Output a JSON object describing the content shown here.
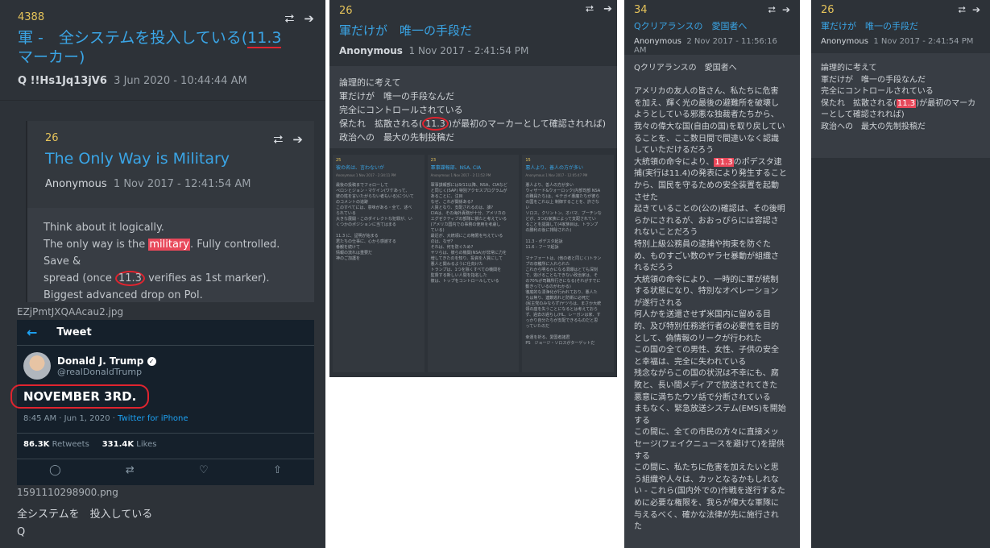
{
  "panel1": {
    "post_number": "4388",
    "title_prefix": "軍 -　全システムを投入している(",
    "title_marker": "11.3",
    "title_suffix": " マーカー)",
    "trip": "Q  !!Hs1Jq13jV6",
    "date": "3 Jun 2020 - 10:44:44 AM",
    "quote": {
      "number": "26",
      "title": "The Only Way is Military",
      "author": "Anonymous",
      "date": "1 Nov 2017 - 12:41:54 AM",
      "line1": "Think about it logically.",
      "line2_a": "The only way is the ",
      "line2_hl": "military",
      "line2_b": ". Fully controlled. Save &",
      "line3_a": "spread (once ",
      "line3_c": "11.3",
      "line3_b": " verifies as 1st marker).",
      "line4": "Biggest advanced drop on Pol."
    },
    "file1": "EZjPmtJXQAAcau2.jpg",
    "tweet": {
      "header": "Tweet",
      "name": "Donald J. Trump",
      "handle": "@realDonaldTrump",
      "text": "NOVEMBER 3RD.",
      "time": "8:45 AM · Jun 1, 2020 · ",
      "source": "Twitter for iPhone",
      "retweets": "86.3K",
      "retweets_label": "Retweets",
      "likes": "331.4K",
      "likes_label": "Likes"
    },
    "file2": "1591110298900.png",
    "footer_line1": "全システムを　投入している",
    "footer_line2": "Q"
  },
  "panel2": {
    "post_number": "26",
    "title": "軍だけが　唯一の手段だ",
    "author": "Anonymous",
    "date": "1 Nov 2017 - 2:41:54 PM",
    "line1": "論理的に考えて",
    "line2": "軍だけが　唯一の手段なんだ",
    "line3": "完全にコントロールされている",
    "line4_a": "保たれ　拡散される(",
    "line4_c": "11.3",
    "line4_b": ")が最初のマーカーとして確認されれば)",
    "line5": "政治への　最大の先制投稿だ",
    "minis": [
      {
        "number": "25",
        "title": "彼の名は、言わないが",
        "meta": "Anonymous  1 Nov 2017 - 2:34:11 PM",
        "body": "最後の投稿までフォローして\nペロシとジョン・マケイン(ワケあって、\n彼の姓を言いたがらない者もいる)について\nのコメントの追跡\nこのすべてには、意味がある・全て、述べ\nられている\n大きな展開・このダイレクトな犯罪が、い\nくつかのポジションに当てはまる\n\n11.3 に、証明が始まる\n君たちの仕事に、心から感謝する\n番観を続けて\n情報の流れは重要だ\n神のご加護を"
      },
      {
        "number": "23",
        "title": "軍事諜報部、NSA, CIA",
        "meta": "Anonymous  1 Nov 2017 - 2:11:52 PM",
        "body": "軍事諜報部には9/11以降、NSA、CIAなど\nと同じく(SAP) 特別アクセスプログラムが\nあることに、注目\nなぜ、これが関係ある?\n人質となり、支配されるのは、誰?\nCIAは、その海外責務が十分、アメリカの\nエグゼクティブの部隊に損たと考えている\n(アメリカ国内での事務の使用を考慮し\nている)\n最近が、大統領にこの権限を与えている\nのは、なぜ?\nそれは、何を防ぐため?\nヤツらは、彼らの機関(NSA)が非常に力を\n増してきたのを知り、投資を人質にして\n悪人と関わるように仕向けた\nトランプは、1つを除くすべての機関を\n監督する新しい人間を指名した\n彼は、トップをコントロールしている"
      },
      {
        "number": "15",
        "title": "悪人より、善人の方が多い",
        "meta": "Anonymous  1 Nov 2017 - 12:05:47 PM",
        "body": "悪人より、善人の方が多い\nウィザード&ウォーロック(内部司部 NSA\nの職員たち)は、キテガイ悪魔たちが彼ら\nの国をこれ以上 制御することを、許さな\nい\nソロス、クリントン、オバマ、プーチンな\nどが、3つの家族によって支配されてい\nることを認識して(4家族目は、トランプ\nの勝利の後に排除された)\n\n11.3 - ポデスタ起訴\n11.6 - フーマ起訴\n\nマナフォートは、(他の者と同じく)トラン\nプの収穫所に入れられた\nこれから明るかになる洞爆はとても深刻\nで、逃げることもできない政治家は、そ\nの70%が司職所行きになる(それがすでに\n動きっているのがわかる)\n徹底的な漂浄化が行われており、悪人た\nちは焦り、連鎖逃れと防衛に必死だ\n(民主党のみならず)ヤツらは、まさか大統\n領の座を失うことになるとは考えておら\nず、過去の過ちし(HL、レーガンは家、す\nっかり自分たちが支配できるものだと思\nっていたのだ\n\n幸運を祈る、愛国者諸君\nPS　ジョージ・ソロスがターゲットだ"
      }
    ]
  },
  "panel3": {
    "post_number": "34",
    "title": "Qクリアランスの　愛国者へ",
    "author": "Anonymous",
    "date": "2 Nov 2017 - 11:56:16 AM",
    "body_a": "Qクリアランスの　愛国者へ\n\nアメリカの友人の皆さん、私たちに危害\nを加え、輝く光の最後の避難所を破壊し\nようとしている邪悪な独裁者たちから、\n我々の偉大な国(自由の国)を取り戻してい\nることを、ここ数日間で間違いなく認識\nしていただけるだろう\n大統領の命令により、",
    "body_hl": "11.3",
    "body_b": "のポデスタ逮\n捕(実行は11.4)の発表により発生すること\nから、国民を守るための安全装置を起動\nさせた\n起きていることの(公の)確認は、その後明\nらかにされるが、おおっぴらには容認さ\nれないことだろう\n特別上級公務員の逮捕や拘束を防ぐた\nめ、ものすごい数のヤラセ暴動が組織さ\nれるだろう\n大統領の命令により、一時的に軍が統制\nする状態になり、特別なオペレーション\nが遂行される\n何人かを送還させず米国内に留める目\n的、及び特別任務遂行者の必要性を目的\nとして、偽情報のリークが行われた\nこの国の全ての男性、女性、子供の安全\nと幸福は、完全に失われている\n残念ながらこの国の状況は不幸にも、腐\n敗と、長い間メディアで放送されてきた\n悪意に満ちたウソ話で分断されている\nまもなく、緊急放送システム(EMS)を開始\nする\nこの間に、全ての市民の方々に直接メッ\nセージ(フェイクニュースを避けて)を提供\nする\nこの間に、私たちに危害を加えたいと思\nう組織や人々は、カッとなるかもしれな\nい - これら(国内外での)作戦を遂行するた\nめに必要な権限を、我らが偉大な軍隊に\n与えるべく、確かな法律が先に施行され\nた"
  },
  "panel4": {
    "post_number": "26",
    "title": "軍だけが　唯一の手段だ",
    "author": "Anonymous",
    "date": "1 Nov 2017 - 2:41:54 PM",
    "line1": "論理的に考えて",
    "line2": "軍だけが　唯一の手段なんだ",
    "line3": "完全にコントロールされている",
    "line4_a": "保たれ　拡散される(",
    "line4_hl": "11.3",
    "line4_b": ")が最初のマーカ",
    "line5": "ーとして確認されれば)",
    "line6": "政治への　最大の先制投稿だ"
  },
  "icons": {
    "share": "share-icon",
    "goto": "arrow-right-circle-icon"
  },
  "colors": {
    "panel_bg": "#2d3238",
    "link": "#3aa5e6",
    "post_number": "#e5c35a",
    "highlight": "#e8485a",
    "annotation_red": "#e0242f"
  }
}
